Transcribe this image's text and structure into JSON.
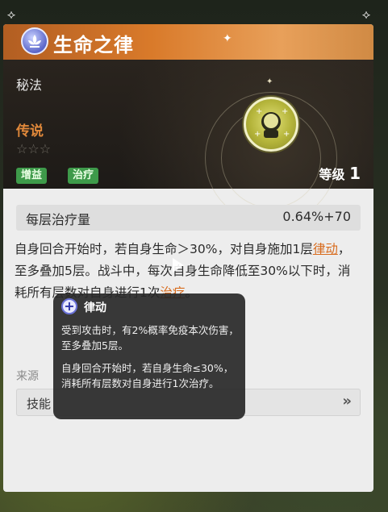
{
  "header": {
    "title": "生命之律"
  },
  "info": {
    "type": "秘法",
    "rarity": "传说",
    "stars": "☆☆☆",
    "tags": [
      "增益",
      "治疗"
    ],
    "level_label": "等级",
    "level_value": "1"
  },
  "stat": {
    "name": "每层治疗量",
    "value": "0.64%+70"
  },
  "description": {
    "part1": "自身回合开始时，若自身生命＞30%，对自身施加1层",
    "kw1": "律动",
    "part2": "，至多叠加5层。战斗中，每次自身生命降低至30%以下时，消耗所有层数对自身进行1次",
    "kw2": "治疗",
    "part3": "。"
  },
  "source": {
    "label": "来源",
    "item": "技能",
    "arrow": "»"
  },
  "tooltip": {
    "title": "律动",
    "para1": "受到攻击时，有2%概率免疫本次伤害，至多叠加5层。",
    "para2": "自身回合开始时，若自身生命≤30%，消耗所有层数对自身进行1次治疗。"
  },
  "colors": {
    "accent": "#d86b1d",
    "tag_green": "#3e9a4a",
    "header_orange": "#d97a2a"
  }
}
